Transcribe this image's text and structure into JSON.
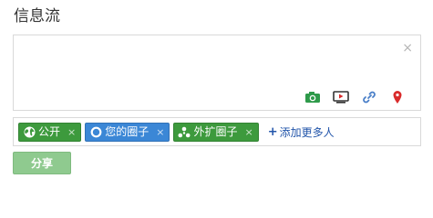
{
  "header": {
    "title": "信息流"
  },
  "composer": {
    "close_label": "×",
    "tools": [
      {
        "icon": "camera-icon",
        "color": "#2e9a4a"
      },
      {
        "icon": "video-icon",
        "color": "#333333"
      },
      {
        "icon": "link-icon",
        "color": "#4a7fc8"
      },
      {
        "icon": "map-pin-icon",
        "color": "#d92b2b"
      }
    ]
  },
  "audience": {
    "chips": [
      {
        "label": "公开",
        "icon": "globe-icon",
        "color": "#3d9a3d",
        "remove": "×"
      },
      {
        "label": "您的圈子",
        "icon": "circle-icon",
        "color": "#3b87d6",
        "remove": "×"
      },
      {
        "label": "外扩圈子",
        "icon": "extended-circles-icon",
        "color": "#3d9a3d",
        "remove": "×"
      }
    ],
    "add_more": {
      "plus": "+",
      "label": "添加更多人"
    }
  },
  "actions": {
    "share_label": "分享"
  }
}
